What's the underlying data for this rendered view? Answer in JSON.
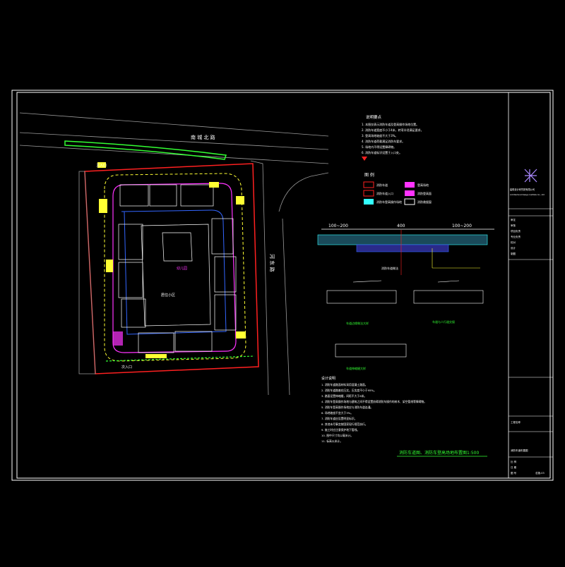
{
  "drawing": {
    "road_north": "南 城 北 路",
    "road_east": "河 东 路",
    "entrance_label": "主入口",
    "entrance_label_2": "次入口",
    "site_label": "居住小区",
    "building_label": "幼儿园"
  },
  "notes": {
    "title": "说明要点",
    "items": [
      "1. 本图仅表示消防车道及登高操作场地位置。",
      "2. 消防车道宽度不小于4米，转弯半径满足要求。",
      "3. 登高场地坡度不大于3%。",
      "4. 消防车道荷载满足消防车要求。",
      "5. 场地内不得设置障碍物。",
      "6. 消防车道标识设置于入口处。"
    ]
  },
  "legend": {
    "title": "图 例",
    "items": [
      "消防车道",
      "登高场地",
      "消防车道入口",
      "消防登高面",
      "消防车登高操作场地",
      "消防救援窗",
      "室外消火栓",
      "消防水泵接合器"
    ]
  },
  "section": {
    "dim_left": "100~200",
    "dim_mid": "400",
    "dim_right": "100~200",
    "label": "消防车道做法",
    "detail_1": "车道边缘做法大样",
    "detail_2": "车道与人行道交接",
    "detail_3": "车道伸缩缝大样"
  },
  "notes2": {
    "title": "设计说明",
    "items": [
      "1. 消防车道路面材料采用混凝土路面。",
      "2. 消防车道路基应压实，压实度不小于95%。",
      "3. 路面设置伸缩缝，间距不大于6米。",
      "4. 消防车登高操作场地与建筑之间不得设置妨碍消防车操作的树木、架空管线等障碍物。",
      "5. 消防车登高操作场地应与消防车道连通。",
      "6. 场地坡度不宜大于3%。",
      "7. 消防车道应设置明显标识。",
      "8. 其他未尽事宜按国家现行规范执行。",
      "9. 施工时应注意保护地下管线。",
      "10. 图中尺寸均以毫米计。",
      "11. 标高以米计。"
    ]
  },
  "main_title": "消防车道图、消防车登高场地布置图1:500",
  "title_block": {
    "company": "建筑设计研究院有限公司",
    "company_en": "Architectural Design Institute Co., Ltd",
    "project": "工程名称",
    "drawing_title": "消防车道布置图",
    "rows": [
      "审定",
      "审核",
      "项目负责",
      "专业负责",
      "校对",
      "设计",
      "制图"
    ],
    "footer": [
      "比 例",
      "日 期",
      "图 号"
    ],
    "sheet": "总施-03"
  },
  "colors": {
    "magenta": "#ff33ff",
    "red": "#ff2020",
    "yellow": "#ffff33",
    "green": "#33ff33",
    "cyan": "#33ffff",
    "blue": "#3366ff",
    "white": "#ffffff",
    "gray": "#9a9a9a"
  }
}
